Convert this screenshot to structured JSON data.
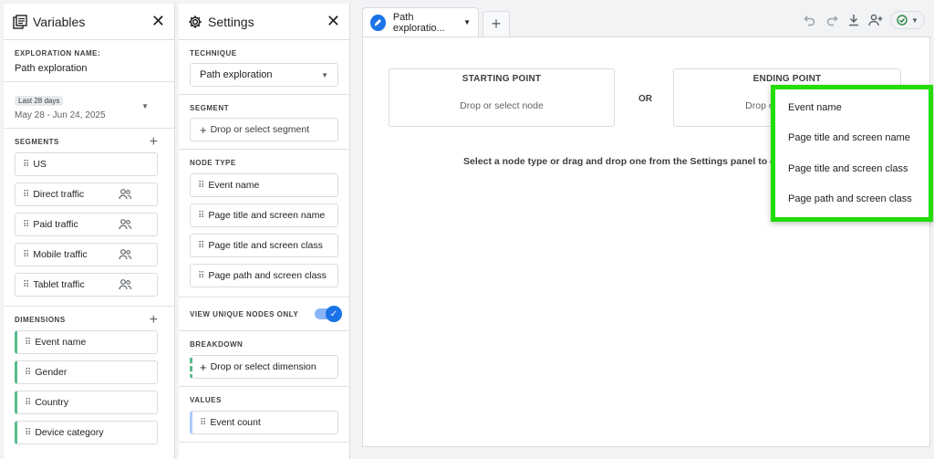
{
  "variables": {
    "title": "Variables",
    "exploration_name_label": "EXPLORATION NAME:",
    "exploration_name": "Path exploration",
    "date_badge": "Last 28 days",
    "date_range": "May 28 - Jun 24, 2025",
    "segments_label": "SEGMENTS",
    "segments": [
      "US",
      "Direct traffic",
      "Paid traffic",
      "Mobile traffic",
      "Tablet traffic"
    ],
    "dimensions_label": "DIMENSIONS",
    "dimensions": [
      "Event name",
      "Gender",
      "Country",
      "Device category"
    ]
  },
  "settings": {
    "title": "Settings",
    "technique_label": "TECHNIQUE",
    "technique_value": "Path exploration",
    "segment_label": "SEGMENT",
    "segment_placeholder": "Drop or select segment",
    "node_type_label": "NODE TYPE",
    "node_types": [
      "Event name",
      "Page title and screen name",
      "Page title and screen class",
      "Page path and screen class"
    ],
    "unique_nodes_label": "VIEW UNIQUE NODES ONLY",
    "breakdown_label": "BREAKDOWN",
    "breakdown_placeholder": "Drop or select dimension",
    "values_label": "VALUES",
    "values_item": "Event count"
  },
  "canvas": {
    "tab_label": "Path exploratio...",
    "starting_point_title": "STARTING POINT",
    "starting_point_hint": "Drop or select node",
    "or_label": "OR",
    "ending_point_title": "ENDING POINT",
    "ending_point_hint": "Drop or select node",
    "instruction": "Select a node type or drag and drop one from the Settings panel to one of the boxes above"
  },
  "dropdown": {
    "items": [
      "Event name",
      "Page title and screen name",
      "Page title and screen class",
      "Page path and screen class"
    ]
  },
  "colors": {
    "accent": "#1a73e8",
    "highlight": "#22dd00",
    "dimension_bar": "#57bb8a"
  }
}
